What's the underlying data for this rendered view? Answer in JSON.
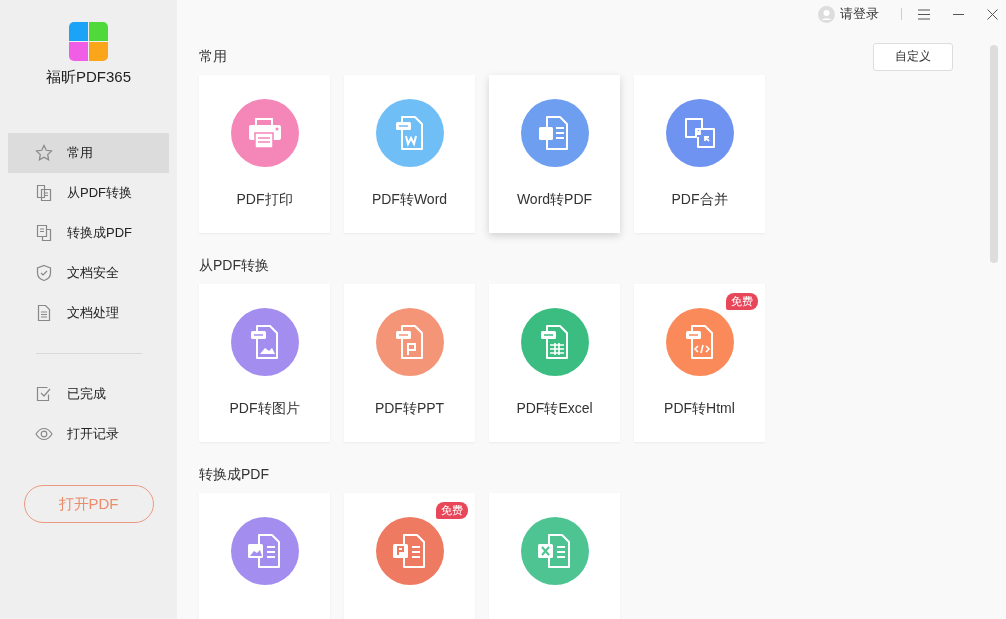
{
  "app": {
    "name": "福昕PDF365"
  },
  "sidebar": {
    "items": [
      {
        "kind": "star",
        "label": "常用",
        "selected": true
      },
      {
        "kind": "from-pdf",
        "label": "从PDF转换",
        "selected": false
      },
      {
        "kind": "to-pdf",
        "label": "转换成PDF",
        "selected": false
      },
      {
        "kind": "shield",
        "label": "文档安全",
        "selected": false
      },
      {
        "kind": "document",
        "label": "文档处理",
        "selected": false
      }
    ],
    "secondary_items": [
      {
        "kind": "done",
        "label": "已完成",
        "selected": false
      },
      {
        "kind": "eye",
        "label": "打开记录",
        "selected": false
      }
    ],
    "open_button": "打开PDF"
  },
  "top_bar": {
    "login": "请登录"
  },
  "customize_button": "自定义",
  "sections": [
    {
      "title": "常用",
      "cards": [
        {
          "kind": "print",
          "label": "PDF打印",
          "color": "#f486b8",
          "highlighted": false
        },
        {
          "kind": "pdf-word",
          "label": "PDF转Word",
          "color": "#6fbef6",
          "highlighted": false
        },
        {
          "kind": "word-pdf",
          "label": "Word转PDF",
          "color": "#6d9ef0",
          "highlighted": true
        },
        {
          "kind": "merge",
          "label": "PDF合并",
          "color": "#6f93f0",
          "highlighted": false
        }
      ]
    },
    {
      "title": "从PDF转换",
      "cards": [
        {
          "kind": "pdf-image",
          "label": "PDF转图片",
          "color": "#a38ef0",
          "highlighted": false
        },
        {
          "kind": "pdf-ppt",
          "label": "PDF转PPT",
          "color": "#f59577",
          "highlighted": false
        },
        {
          "kind": "pdf-excel",
          "label": "PDF转Excel",
          "color": "#3bbd81",
          "highlighted": false
        },
        {
          "kind": "pdf-html",
          "label": "PDF转Html",
          "color": "#fb8a5a",
          "highlighted": false,
          "badge": "免费"
        }
      ]
    },
    {
      "title": "转换成PDF",
      "cards": [
        {
          "kind": "image-pdf",
          "color": "#a38ef0",
          "highlighted": false
        },
        {
          "kind": "ppt-pdf",
          "color": "#ee7a62",
          "highlighted": false,
          "badge": "免费"
        },
        {
          "kind": "excel-pdf",
          "color": "#4fc493",
          "highlighted": false
        }
      ]
    }
  ]
}
